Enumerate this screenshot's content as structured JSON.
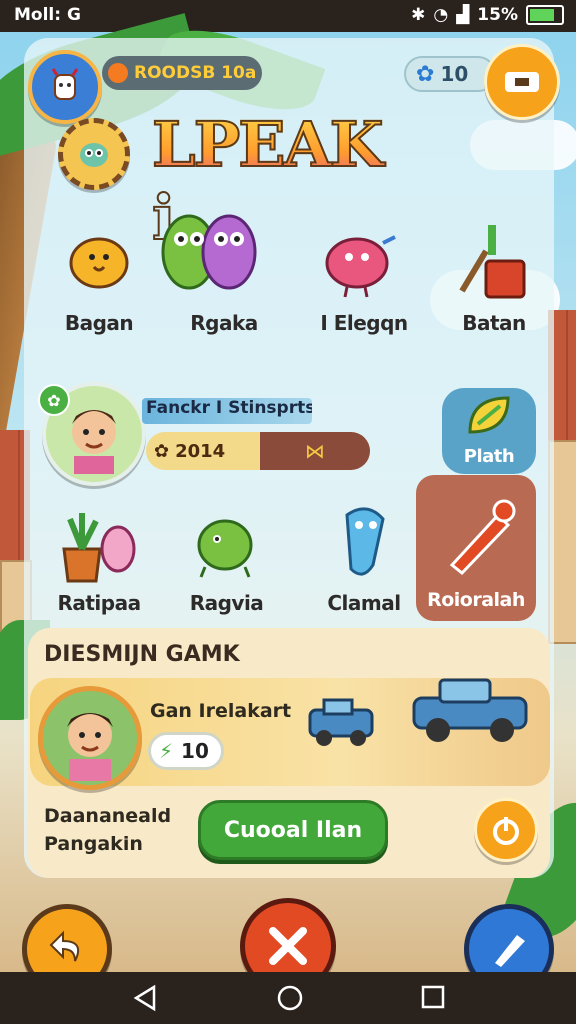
{
  "status_bar": {
    "left_text": "Moll: G",
    "battery": "15%"
  },
  "header": {
    "currency_label": "ROODSB 10a",
    "gems_value": "10",
    "title": "LPEAK i"
  },
  "games_row1": [
    {
      "label": "Bagan",
      "icon": "bird-icon"
    },
    {
      "label": "Rgaka",
      "icon": "owls-icon"
    },
    {
      "label": "I Elegqn",
      "icon": "pink-bird-icon"
    },
    {
      "label": "Batan",
      "icon": "toolbox-icon"
    }
  ],
  "profile": {
    "name": "Fanckr I Stinsprts",
    "score": "2014",
    "side_button": "Plath"
  },
  "games_row2": [
    {
      "label": "Ratipaa",
      "icon": "plant-icon"
    },
    {
      "label": "Ragvia",
      "icon": "lizard-icon"
    },
    {
      "label": "Clamal",
      "icon": "blue-creature-icon"
    },
    {
      "label": "Roioralah",
      "icon": "pencil-icon"
    }
  ],
  "section": {
    "heading": "DIESMIJN GAMK",
    "player_name": "Gan Irelakart",
    "energy_value": "10",
    "caption_line1": "Daananeald",
    "caption_line2": "Pangakin",
    "primary_button": "Cuooal Ilan"
  },
  "colors": {
    "accent_orange": "#f7a21b",
    "primary_green": "#43a83a",
    "close_red": "#e24a23",
    "panel": "#e8f6f8"
  }
}
